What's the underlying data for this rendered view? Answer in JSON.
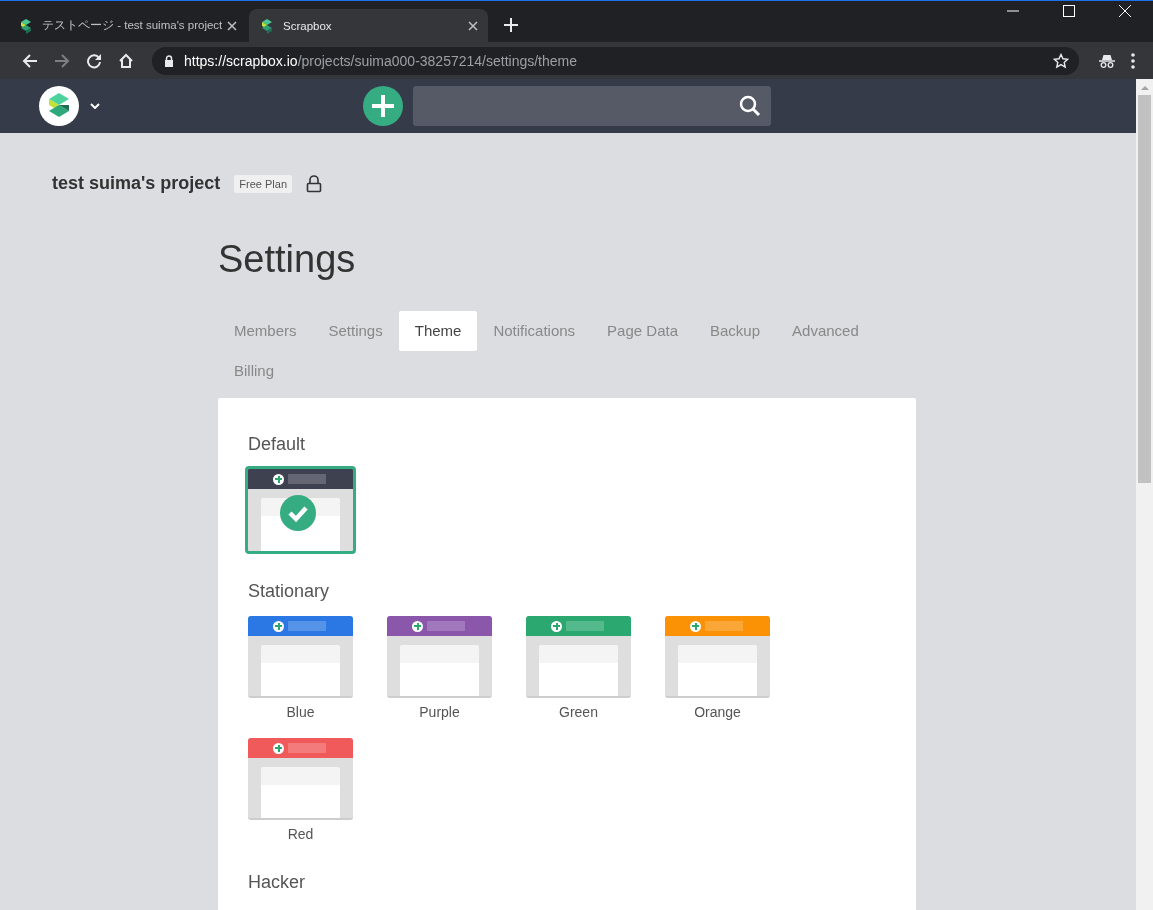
{
  "browser": {
    "tabs": [
      {
        "title": "テストページ - test suima's project",
        "selected": false
      },
      {
        "title": "Scrapbox",
        "selected": true
      }
    ],
    "address": {
      "origin": "https://scrapbox.io",
      "path": "/projects/suima000-38257214/settings/theme"
    }
  },
  "project": {
    "name": "test suima's project",
    "plan": "Free Plan"
  },
  "heading": "Settings",
  "tabs": [
    {
      "label": "Members",
      "selected": false
    },
    {
      "label": "Settings",
      "selected": false
    },
    {
      "label": "Theme",
      "selected": true
    },
    {
      "label": "Notifications",
      "selected": false
    },
    {
      "label": "Page Data",
      "selected": false
    },
    {
      "label": "Backup",
      "selected": false
    },
    {
      "label": "Advanced",
      "selected": false
    },
    {
      "label": "Billing",
      "selected": false
    }
  ],
  "theme_groups": [
    {
      "title": "Default",
      "themes": [
        {
          "color": "#3e4250",
          "selected": true
        }
      ]
    },
    {
      "title": "Stationary",
      "themes": [
        {
          "label": "Blue",
          "color": "#2b78e4",
          "selected": false
        },
        {
          "label": "Purple",
          "color": "#8a57aa",
          "selected": false
        },
        {
          "label": "Green",
          "color": "#2aa870",
          "selected": false
        },
        {
          "label": "Orange",
          "color": "#fb9105",
          "selected": false
        },
        {
          "label": "Red",
          "color": "#f05a5a",
          "selected": false
        }
      ]
    },
    {
      "title": "Hacker"
    }
  ]
}
